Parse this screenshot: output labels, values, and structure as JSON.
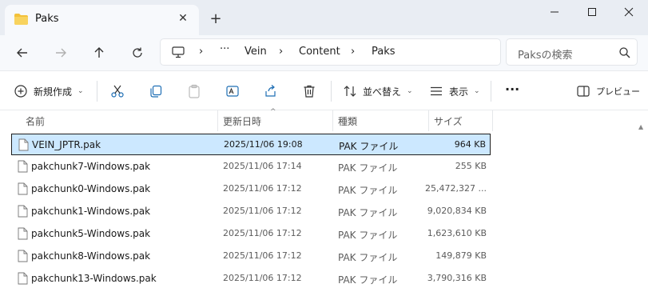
{
  "tab": {
    "title": "Paks",
    "close_glyph": "✕",
    "new_tab_glyph": "+"
  },
  "window": {
    "minimize": "minimize-icon",
    "maximize": "maximize-icon",
    "close": "close-icon"
  },
  "nav": {
    "back": "back-arrow-icon",
    "forward": "forward-arrow-icon",
    "up": "up-arrow-icon",
    "refresh": "refresh-icon"
  },
  "address": {
    "ellipsis": "···",
    "crumbs": [
      "Vein",
      "Content",
      "Paks"
    ],
    "separator": "›"
  },
  "search": {
    "placeholder": "Paksの検索"
  },
  "toolbar": {
    "new_label": "新規作成",
    "sort_label": "並べ替え",
    "view_label": "表示",
    "more_label": "···",
    "preview_label": "プレビュー",
    "chevron": "⌄"
  },
  "columns": {
    "name": "名前",
    "date": "更新日時",
    "type": "種類",
    "size": "サイズ",
    "sort_caret": "^"
  },
  "files": [
    {
      "name": "VEIN_JPTR.pak",
      "date": "2025/11/06 19:08",
      "type": "PAK ファイル",
      "size": "964 KB",
      "selected": true
    },
    {
      "name": "pakchunk7-Windows.pak",
      "date": "2025/11/06 17:14",
      "type": "PAK ファイル",
      "size": "255 KB",
      "selected": false
    },
    {
      "name": "pakchunk0-Windows.pak",
      "date": "2025/11/06 17:12",
      "type": "PAK ファイル",
      "size": "25,472,327 ...",
      "selected": false
    },
    {
      "name": "pakchunk1-Windows.pak",
      "date": "2025/11/06 17:12",
      "type": "PAK ファイル",
      "size": "9,020,834 KB",
      "selected": false
    },
    {
      "name": "pakchunk5-Windows.pak",
      "date": "2025/11/06 17:12",
      "type": "PAK ファイル",
      "size": "1,623,610 KB",
      "selected": false
    },
    {
      "name": "pakchunk8-Windows.pak",
      "date": "2025/11/06 17:12",
      "type": "PAK ファイル",
      "size": "149,879 KB",
      "selected": false
    },
    {
      "name": "pakchunk13-Windows.pak",
      "date": "2025/11/06 17:12",
      "type": "PAK ファイル",
      "size": "3,790,316 KB",
      "selected": false
    }
  ],
  "colors": {
    "selection": "#cce8ff",
    "folder": "#f3c13a",
    "accent": "#0067c0"
  }
}
